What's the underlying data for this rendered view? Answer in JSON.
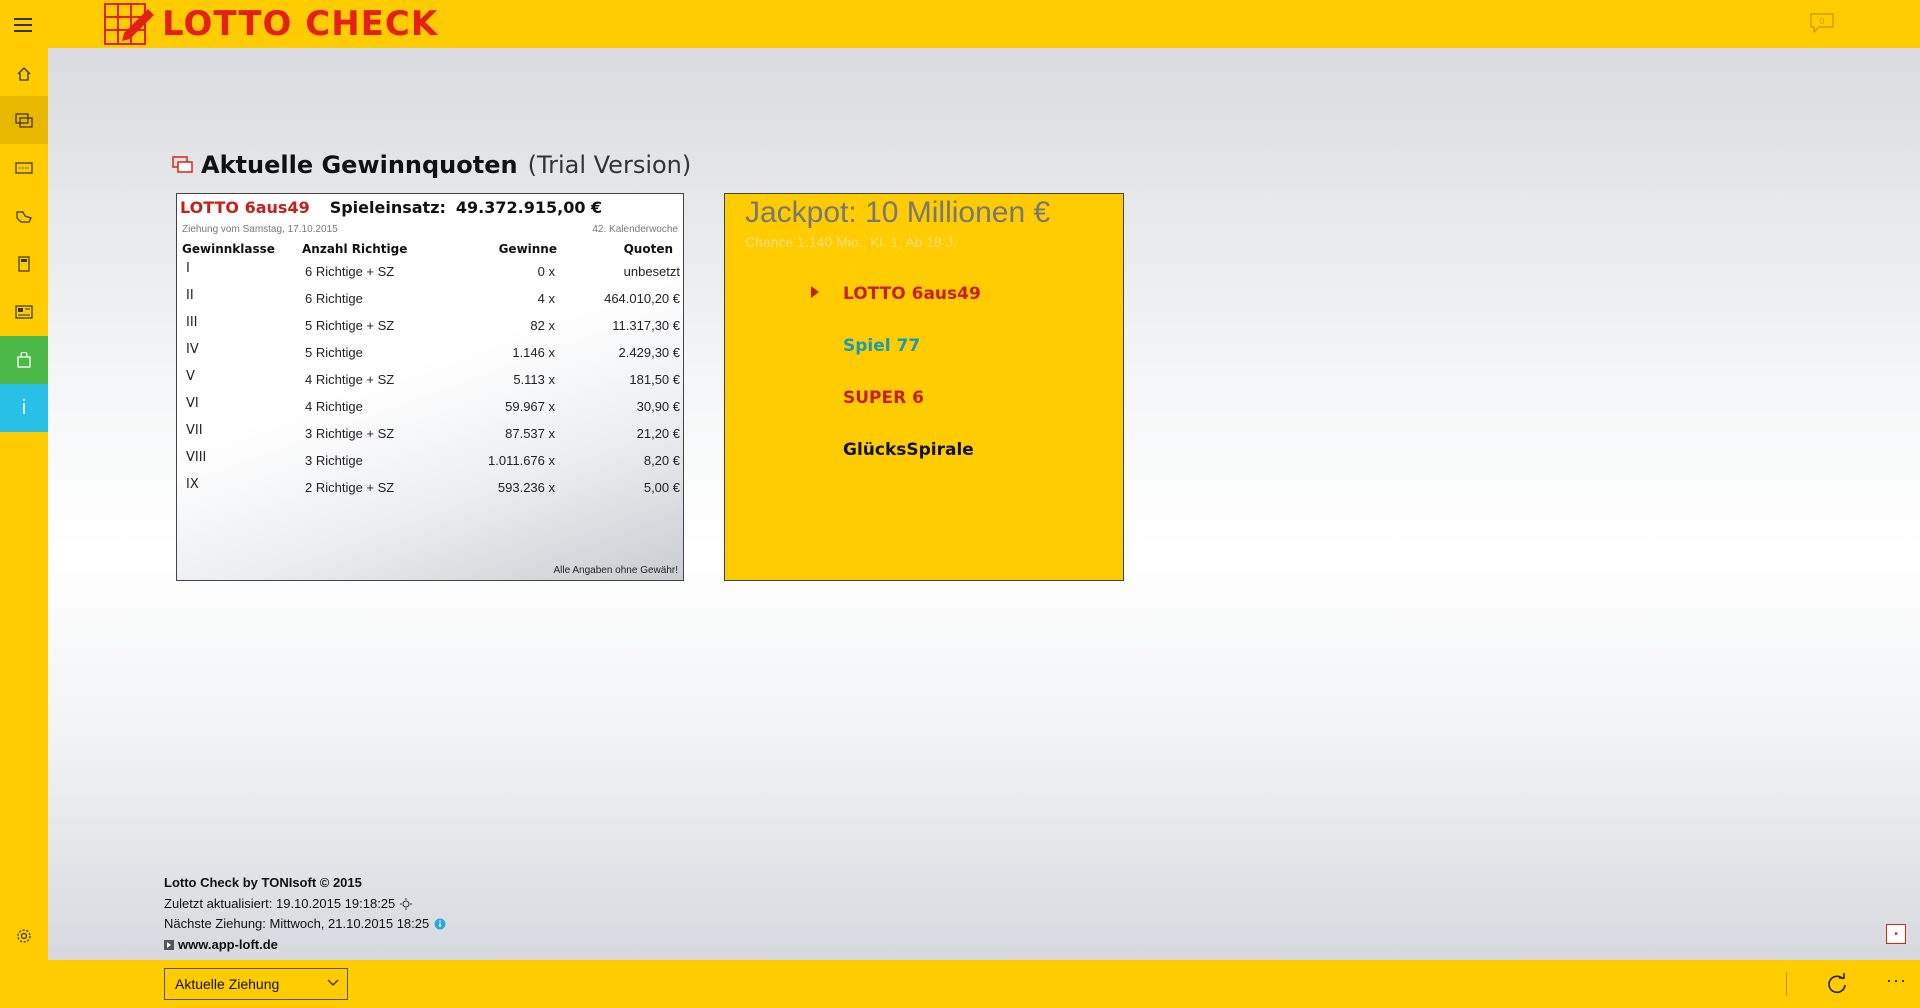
{
  "header": {
    "app_title": "LOTTO CHECK",
    "notification_count": "0"
  },
  "sidebar": {
    "items": [
      {
        "name": "home",
        "icon": "home-icon"
      },
      {
        "name": "quotes",
        "icon": "quotes-icon"
      },
      {
        "name": "tickets",
        "icon": "ticket-icon"
      },
      {
        "name": "check",
        "icon": "check-hand-icon"
      },
      {
        "name": "calculator",
        "icon": "calculator-icon"
      },
      {
        "name": "news",
        "icon": "news-icon"
      },
      {
        "name": "shop",
        "icon": "shopping-bag-icon"
      },
      {
        "name": "info",
        "icon": "info-icon",
        "label": "i"
      }
    ],
    "settings_icon": "gear-icon"
  },
  "page": {
    "title": "Aktuelle Gewinnquoten",
    "subtitle": "(Trial Version)"
  },
  "quota_card": {
    "brand": "LOTTO 6aus49",
    "stake_label": "Spieleinsatz:",
    "stake_value": "49.372.915,00 €",
    "draw_date": "Ziehung vom Samstag, 17.10.2015",
    "week": "42. Kalenderwoche",
    "columns": [
      "Gewinnklasse",
      "Anzahl Richtige",
      "Gewinne",
      "Quoten"
    ],
    "rows": [
      {
        "class": "I",
        "match": "6 Richtige + SZ",
        "winners": "0 x",
        "quote": "unbesetzt"
      },
      {
        "class": "II",
        "match": "6 Richtige",
        "winners": "4 x",
        "quote": "464.010,20 €"
      },
      {
        "class": "III",
        "match": "5 Richtige + SZ",
        "winners": "82 x",
        "quote": "11.317,30 €"
      },
      {
        "class": "IV",
        "match": "5 Richtige",
        "winners": "1.146 x",
        "quote": "2.429,30 €"
      },
      {
        "class": "V",
        "match": "4 Richtige + SZ",
        "winners": "5.113 x",
        "quote": "181,50 €"
      },
      {
        "class": "VI",
        "match": "4 Richtige",
        "winners": "59.967 x",
        "quote": "30,90 €"
      },
      {
        "class": "VII",
        "match": "3 Richtige + SZ",
        "winners": "87.537 x",
        "quote": "21,20 €"
      },
      {
        "class": "VIII",
        "match": "3 Richtige",
        "winners": "1.011.676 x",
        "quote": "8,20 €"
      },
      {
        "class": "IX",
        "match": "2 Richtige + SZ",
        "winners": "593.236 x",
        "quote": "5,00 €"
      }
    ],
    "footer": "Alle Angaben ohne Gewähr!"
  },
  "jackpot": {
    "title": "Jackpot: 10 Millionen €",
    "subtitle": "Chance 1:140 Mio., Kl. 1, Ab 18 J.",
    "games": [
      {
        "label": "LOTTO 6aus49",
        "color": "#c7201b",
        "selected": true
      },
      {
        "label": "Spiel 77",
        "color": "#1a9bb0",
        "selected": false
      },
      {
        "label": "SUPER 6",
        "color": "#c7201b",
        "selected": false
      },
      {
        "label": "GlücksSpirale",
        "color": "#111111",
        "selected": false
      }
    ]
  },
  "footer_info": {
    "copyright": "Lotto Check by TONIsoft © 2015",
    "last_updated": "Zuletzt aktualisiert: 19.10.2015 19:18:25",
    "next_draw": "Nächste Ziehung: Mittwoch, 21.10.2015 18:25",
    "website": "www.app-loft.de"
  },
  "bottombar": {
    "draw_select_value": "Aktuelle Ziehung",
    "more_label": "···"
  },
  "colors": {
    "brand_yellow": "#ffcc00",
    "brand_red": "#e32119",
    "active_green": "#4cb848",
    "info_cyan": "#29c0e8"
  }
}
